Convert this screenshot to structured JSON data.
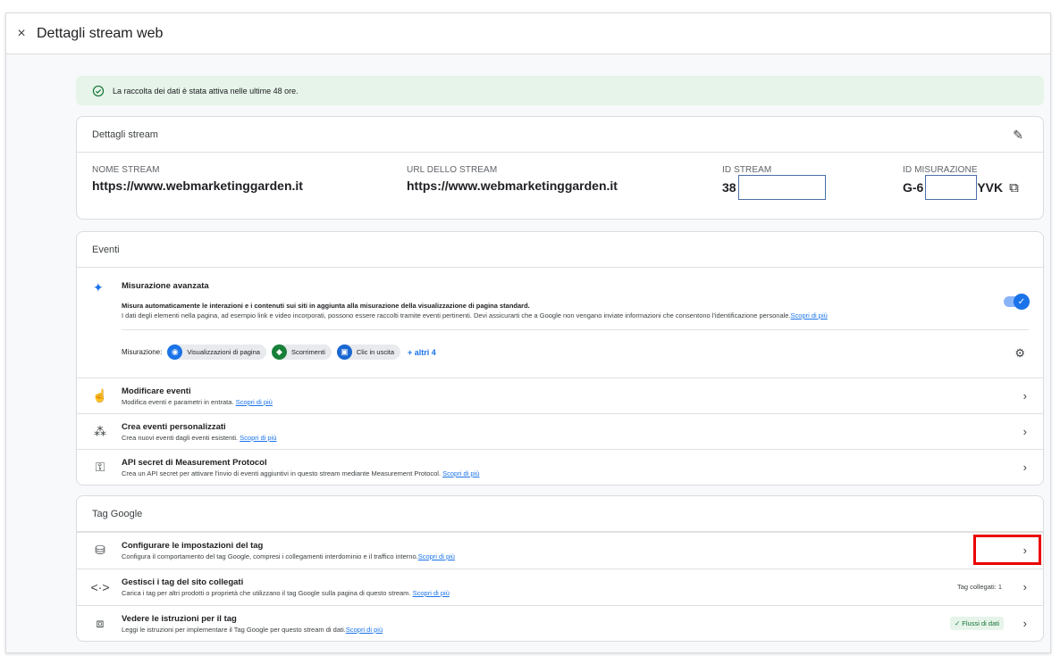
{
  "header": {
    "close_icon": "×",
    "title": "Dettagli stream web"
  },
  "banner": {
    "icon": "check-circle-icon",
    "message": "La raccolta dei dati è stata attiva nelle ultime 48 ore."
  },
  "details": {
    "heading": "Dettagli stream",
    "fields": [
      {
        "label": "NOME STREAM",
        "value": "https://www.webmarketinggarden.it"
      },
      {
        "label": "URL DELLO STREAM",
        "value": "https://www.webmarketinggarden.it"
      },
      {
        "label": "ID STREAM",
        "value": "38"
      },
      {
        "label": "ID MISURAZIONE",
        "value_prefix": "G-6",
        "value_suffix": "YVK"
      }
    ]
  },
  "events": {
    "heading": "Eventi",
    "advanced": {
      "title": "Misurazione avanzata",
      "desc_bold": "Misura automaticamente le interazioni e i contenuti sui siti in aggiunta alla misurazione della visualizzazione di pagina standard.",
      "desc": "I dati degli elementi nella pagina, ad esempio link e video incorporati, possono essere raccolti tramite eventi pertinenti. Devi assicurarti che a Google non vengano inviate informazioni che consentono l'identificazione personale.",
      "link": "Scopri di più",
      "toggle_on": true,
      "measurement_label": "Misurazione:",
      "chips": [
        "Visualizzazioni di pagina",
        "Scorrimenti",
        "Clic in uscita"
      ],
      "more": "+ altri 4"
    },
    "rows": [
      {
        "title": "Modificare eventi",
        "desc": "Modifica eventi e parametri in entrata.",
        "link": "Scopri di più"
      },
      {
        "title": "Crea eventi personalizzati",
        "desc": "Crea nuovi eventi dagli eventi esistenti.",
        "link": "Scopri di più"
      },
      {
        "title": "API secret di Measurement Protocol",
        "desc": "Crea un API secret per attivare l'invio di eventi aggiuntivi in questo stream mediante Measurement Protocol.",
        "link": "Scopri di più"
      }
    ]
  },
  "tags": {
    "heading": "Tag Google",
    "rows": [
      {
        "title": "Configurare le impostazioni del tag",
        "desc": "Configura il comportamento del tag Google, compresi i collegamenti interdominio e il traffico interno.",
        "link": "Scopri di più"
      },
      {
        "title": "Gestisci i tag del sito collegati",
        "desc": "Carica i tag per altri prodotti o proprietà che utilizzano il tag Google sulla pagina di questo stream.",
        "link": "Scopri di più",
        "badge": "Tag collegati: 1"
      },
      {
        "title": "Vedere le istruzioni per il tag",
        "desc": "Leggi le istruzioni per implementare il Tag Google per questo stream di dati.",
        "link": "Scopri di più",
        "badge": "✓ Flussi di dati"
      }
    ]
  },
  "colors": {
    "accent": "#1a73e8",
    "banner_bg": "#e6f4ea",
    "highlight": "#ea0000"
  }
}
